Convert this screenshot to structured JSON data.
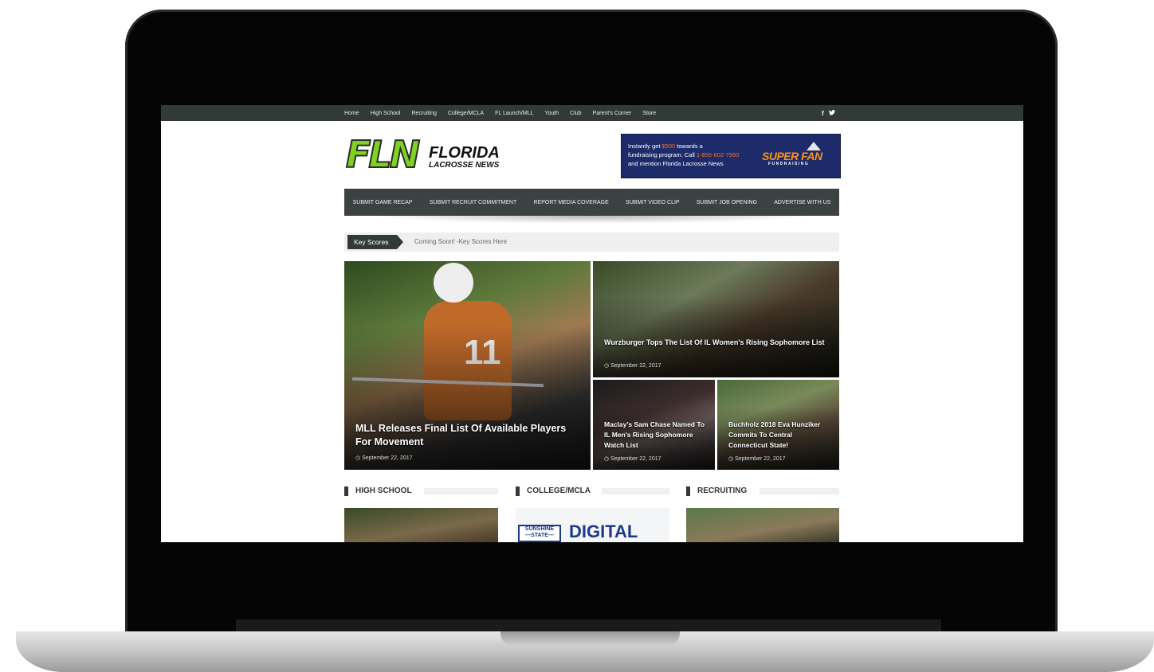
{
  "topnav": {
    "items": [
      "Home",
      "High School",
      "Recruiting",
      "College/MCLA",
      "FL Launch/MLL",
      "Youth",
      "Club",
      "Parent's Corner",
      "Store"
    ],
    "social": [
      "f",
      "🐦"
    ]
  },
  "logo": {
    "fln": "FLN",
    "word1": "FLORIDA",
    "word2": "LACROSSE NEWS"
  },
  "ad": {
    "line1_a": "Instantly get ",
    "line1_hl": "$500",
    "line1_b": " towards a",
    "line2_a": "fundraising program. Call ",
    "line2_hl": "1-855-602-7990",
    "line3": "and mention Florida Lacrosse News",
    "brand": "SUPER FAN",
    "brand_sub": "FUNDRAISING"
  },
  "submitbar": [
    "SUBMIT GAME RECAP",
    "SUBMIT RECRUIT COMMITMENT",
    "REPORT MEDIA COVERAGE",
    "SUBMIT VIDEO CLIP",
    "SUBMIT JOB OPENING",
    "ADVERTISE WITH US"
  ],
  "scores": {
    "label": "Key Scores",
    "text": "Coming Soon! -Key Scores Here"
  },
  "featured": [
    {
      "title": "MLL Releases Final List Of Available Players For Movement",
      "date": "September 22, 2017"
    },
    {
      "title": "Wurzburger Tops The List Of IL Women's Rising Sophomore List",
      "date": "September 22, 2017"
    },
    {
      "title": "Maclay's Sam Chase Named To IL Men's Rising Sophomore Watch List",
      "date": "September 22, 2017"
    },
    {
      "title": "Buchholz 2018 Eva Hunziker Commits To Central Connecticut State!",
      "date": "September 22, 2017"
    }
  ],
  "sections": [
    "HIGH SCHOOL",
    "COLLEGE/MCLA",
    "RECRUITING"
  ],
  "college_thumb": {
    "badge1": "SUNSHINE",
    "badge2": "—STATE—",
    "digital": "DIGITAL"
  },
  "colors": {
    "nav_bg": "#323a38",
    "logo_green": "#7ed321",
    "ad_bg": "#1d2b6b",
    "ad_accent": "#f36f21"
  }
}
